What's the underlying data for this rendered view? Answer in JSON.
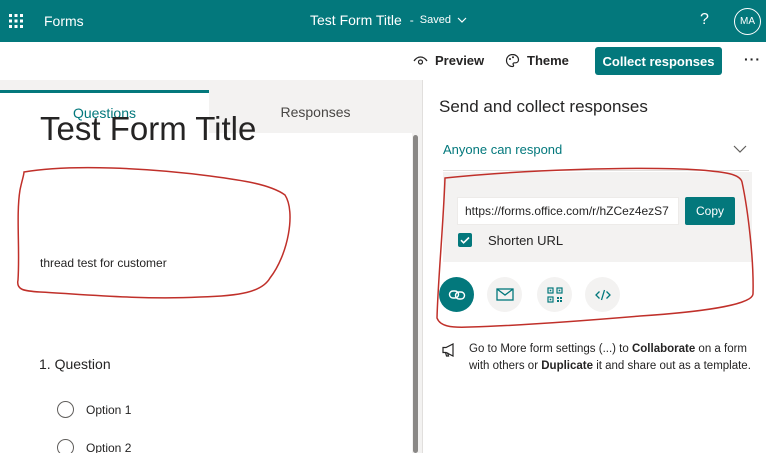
{
  "topbar": {
    "waffle_icon": "waffle-icon",
    "app_name": "Forms",
    "form_title": "Test Form Title",
    "separator": "-",
    "save_status": "Saved",
    "help_label": "?",
    "avatar_initials": "MA"
  },
  "toolbar": {
    "preview_label": "Preview",
    "theme_label": "Theme",
    "collect_label": "Collect responses",
    "more_label": "···"
  },
  "tabs": {
    "questions": "Questions",
    "responses": "Responses"
  },
  "form": {
    "title": "Test Form Title",
    "description": "thread test for customer",
    "question": "1. Question",
    "options": [
      "Option 1",
      "Option 2"
    ]
  },
  "share_panel": {
    "title": "Send and collect responses",
    "audience": "Anyone can respond",
    "url": "https://forms.office.com/r/hZCez4ezS7",
    "copy_label": "Copy",
    "shorten_label": "Shorten URL",
    "shorten_checked": true,
    "share_methods": [
      "link-icon",
      "email-icon",
      "qr-code-icon",
      "embed-icon"
    ],
    "note_parts": {
      "p1": "Go to More form settings (...) to ",
      "b1": "Collaborate",
      "p2": " on a form with others or ",
      "b2": "Duplicate",
      "p3": " it and share out as a template."
    }
  },
  "colors": {
    "brand": "#03787c",
    "annotation": "#c0302a"
  }
}
